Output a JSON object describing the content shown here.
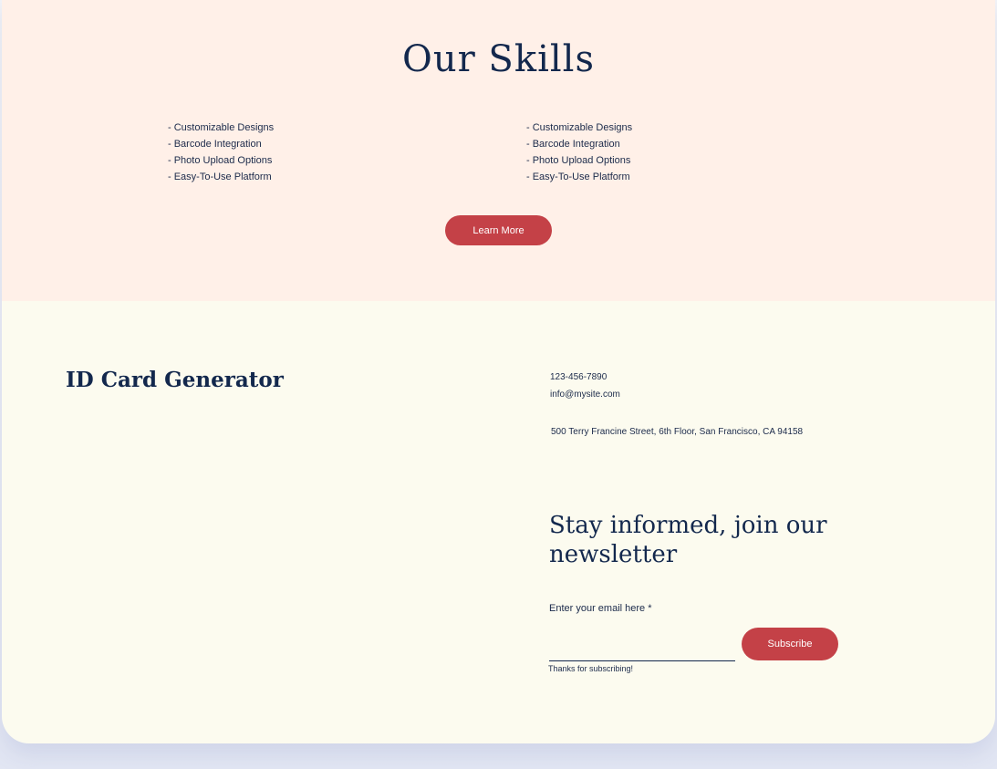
{
  "skills": {
    "title": "Our Skills",
    "left_items": [
      "- Customizable Designs",
      "- Barcode Integration",
      "- Photo Upload Options",
      "- Easy-To-Use Platform"
    ],
    "right_items": [
      "- Customizable Designs",
      "- Barcode Integration",
      "- Photo Upload Options",
      "- Easy-To-Use Platform"
    ],
    "button_label": "Learn More"
  },
  "footer": {
    "brand": "ID Card Generator",
    "phone": "123-456-7890",
    "email": "info@mysite.com",
    "address": "500 Terry Francine Street, 6th Floor, San Francisco, CA 94158",
    "newsletter_title": "Stay informed, join our newsletter",
    "email_label": "Enter your email here *",
    "email_value": "",
    "subscribe_label": "Subscribe",
    "thanks_text": "Thanks for subscribing!"
  },
  "colors": {
    "skills_bg": "#fff0e8",
    "footer_bg": "#fcfbef",
    "accent": "#c44147",
    "text_dark": "#13284d"
  }
}
